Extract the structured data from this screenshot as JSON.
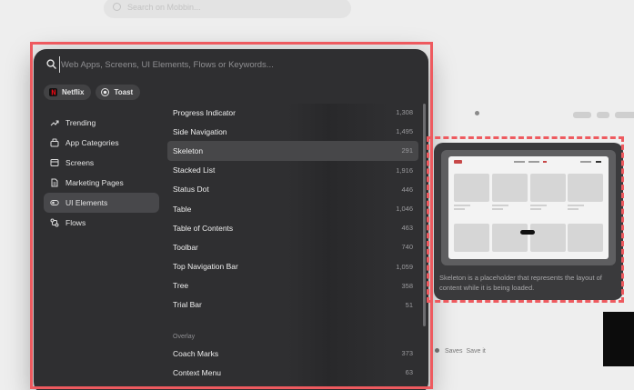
{
  "background": {
    "search_placeholder": "Search on Mobbin...",
    "breadcrumb": [
      "Saves",
      "Save it"
    ]
  },
  "search": {
    "placeholder": "Web Apps, Screens, UI Elements, Flows or Keywords..."
  },
  "chips": [
    {
      "label": "Netflix",
      "icon": "netflix-logo-icon"
    },
    {
      "label": "Toast",
      "icon": "toast-logo-icon"
    }
  ],
  "categories": [
    {
      "label": "Trending",
      "icon": "trending-icon"
    },
    {
      "label": "App Categories",
      "icon": "app-categories-icon"
    },
    {
      "label": "Screens",
      "icon": "screens-icon"
    },
    {
      "label": "Marketing Pages",
      "icon": "document-icon"
    },
    {
      "label": "UI Elements",
      "icon": "ui-elements-icon",
      "active": true
    },
    {
      "label": "Flows",
      "icon": "flows-icon"
    }
  ],
  "elements": [
    {
      "label": "Progress Indicator",
      "count": "1,308"
    },
    {
      "label": "Side Navigation",
      "count": "1,495"
    },
    {
      "label": "Skeleton",
      "count": "291",
      "active": true
    },
    {
      "label": "Stacked List",
      "count": "1,916"
    },
    {
      "label": "Status Dot",
      "count": "446"
    },
    {
      "label": "Table",
      "count": "1,046"
    },
    {
      "label": "Table of Contents",
      "count": "463"
    },
    {
      "label": "Toolbar",
      "count": "740"
    },
    {
      "label": "Top Navigation Bar",
      "count": "1,059"
    },
    {
      "label": "Tree",
      "count": "358"
    },
    {
      "label": "Trial Bar",
      "count": "51"
    }
  ],
  "overlay_section": {
    "title": "Overlay",
    "items": [
      {
        "label": "Coach Marks",
        "count": "373"
      },
      {
        "label": "Context Menu",
        "count": "63"
      }
    ]
  },
  "preview": {
    "description": "Skeleton is a placeholder that represents the layout of content while it is being loaded."
  },
  "colors": {
    "panel": "#2f2f31",
    "accent_outline": "#ee5a5f",
    "netflix_red": "#e50914"
  }
}
